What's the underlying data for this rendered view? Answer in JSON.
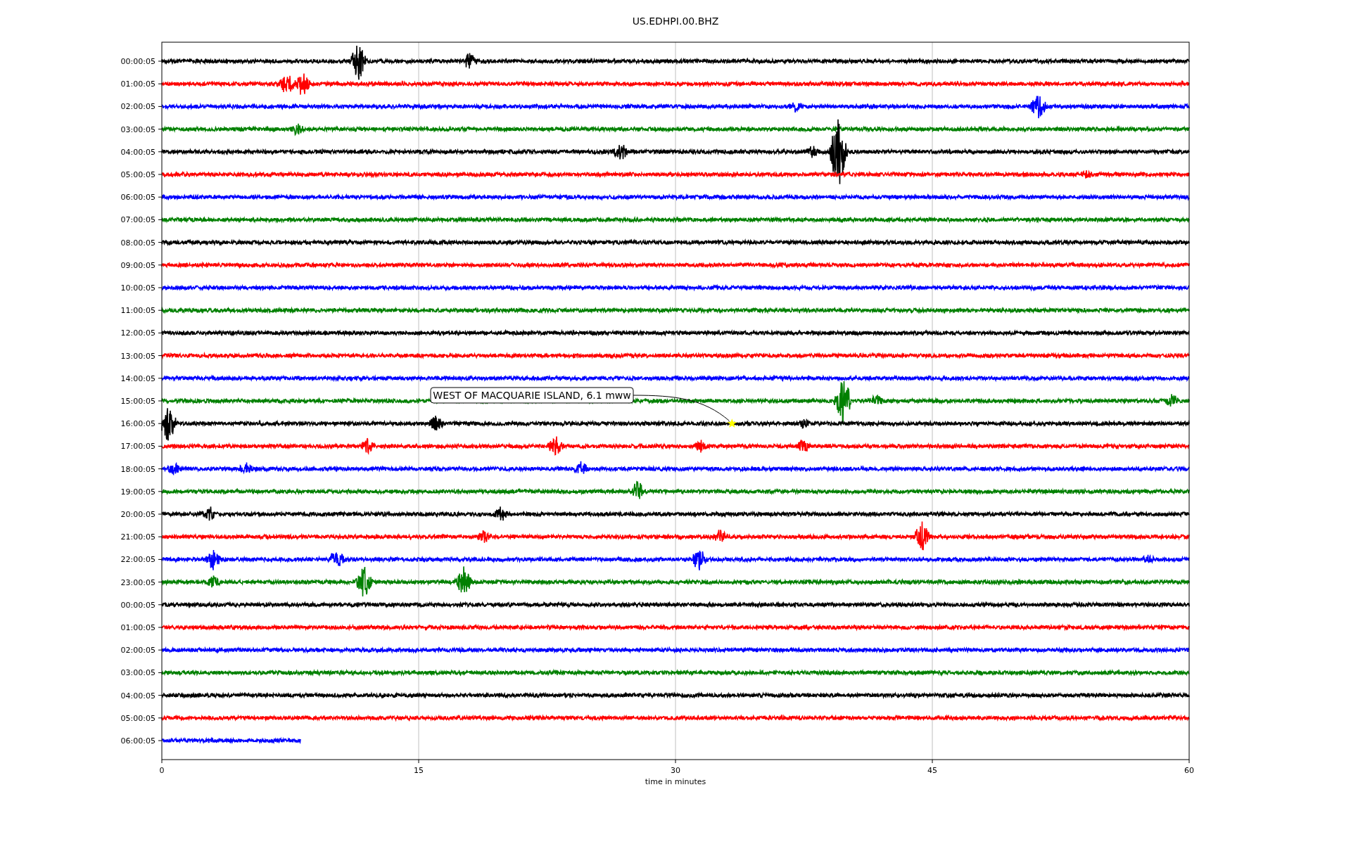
{
  "title": "US.EDHPI.00.BHZ",
  "traces": [
    {
      "label": "00:00:05",
      "color": "#000000",
      "level": 1
    },
    {
      "label": "01:00:05",
      "color": "#ff0000",
      "level": 1
    },
    {
      "label": "02:00:05",
      "color": "#0000ff",
      "level": 1
    },
    {
      "label": "03:00:05",
      "color": "#008000",
      "level": 1
    },
    {
      "label": "04:00:05",
      "color": "#000000",
      "level": 1
    },
    {
      "label": "05:00:05",
      "color": "#ff0000",
      "level": 1
    },
    {
      "label": "06:00:05",
      "color": "#0000ff",
      "level": 1
    },
    {
      "label": "07:00:05",
      "color": "#008000",
      "level": 1
    },
    {
      "label": "08:00:05",
      "color": "#000000",
      "level": 1
    },
    {
      "label": "09:00:05",
      "color": "#ff0000",
      "level": 1
    },
    {
      "label": "10:00:05",
      "color": "#0000ff",
      "level": 1
    },
    {
      "label": "11:00:05",
      "color": "#008000",
      "level": 1
    },
    {
      "label": "12:00:05",
      "color": "#000000",
      "level": 1
    },
    {
      "label": "13:00:05",
      "color": "#ff0000",
      "level": 1
    },
    {
      "label": "14:00:05",
      "color": "#0000ff",
      "level": 1
    },
    {
      "label": "15:00:05",
      "color": "#008000",
      "level": 1
    },
    {
      "label": "16:00:05",
      "color": "#000000",
      "level": 1
    },
    {
      "label": "17:00:05",
      "color": "#ff0000",
      "level": 1
    },
    {
      "label": "18:00:05",
      "color": "#0000ff",
      "level": 1
    },
    {
      "label": "19:00:05",
      "color": "#008000",
      "level": 1
    },
    {
      "label": "20:00:05",
      "color": "#000000",
      "level": 1
    },
    {
      "label": "21:00:05",
      "color": "#ff0000",
      "level": 1
    },
    {
      "label": "22:00:05",
      "color": "#0000ff",
      "level": 1
    },
    {
      "label": "23:00:05",
      "color": "#008000",
      "level": 1
    },
    {
      "label": "00:00:05",
      "color": "#000000",
      "level": 1
    },
    {
      "label": "01:00:05",
      "color": "#ff0000",
      "level": 1
    },
    {
      "label": "02:00:05",
      "color": "#0000ff",
      "level": 1
    },
    {
      "label": "03:00:05",
      "color": "#008000",
      "level": 1
    },
    {
      "label": "04:00:05",
      "color": "#000000",
      "level": 1
    },
    {
      "label": "05:00:05",
      "color": "#ff0000",
      "level": 1
    },
    {
      "label": "06:00:05",
      "color": "#0000ff",
      "level": 0.135
    }
  ],
  "annotation": {
    "text": "WEST OF MACQUARIE ISLAND, 6.1 mww"
  },
  "x_axis": {
    "ticks": [
      "0",
      "15",
      "30",
      "45",
      "60"
    ],
    "label": "time in minutes"
  }
}
